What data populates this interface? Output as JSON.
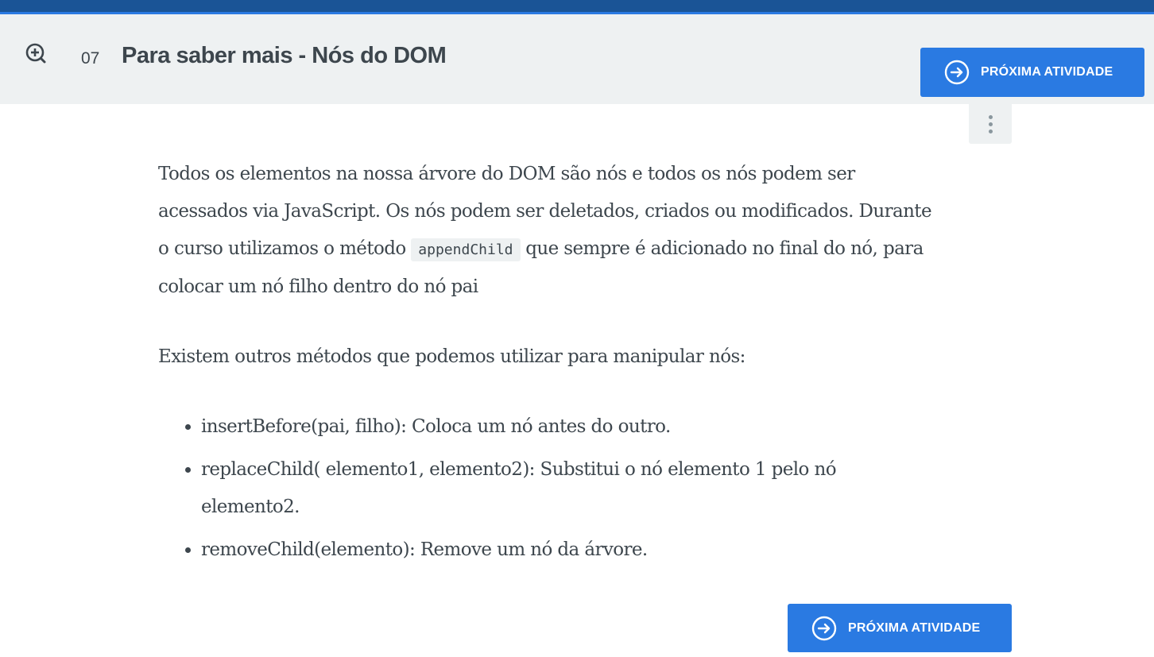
{
  "header": {
    "lesson_number": "07",
    "title": "Para saber mais - Nós do DOM",
    "next_button_label": "PRÓXIMA ATIVIDADE"
  },
  "content": {
    "paragraph1_part1": "Todos os elementos na nossa árvore do DOM são nós e todos os nós podem ser acessados via JavaScript. Os nós podem ser deletados, criados ou modificados. Durante o curso utilizamos o método ",
    "paragraph1_code": "appendChild",
    "paragraph1_part2": " que sempre é adicionado no final do nó, para colocar um nó filho dentro do nó pai",
    "paragraph2": "Existem outros métodos que podemos utilizar para manipular nós:",
    "methods": [
      "insertBefore(pai, filho): Coloca um nó antes do outro.",
      "replaceChild( elemento1, elemento2): Substitui o nó elemento 1 pelo nó elemento2.",
      "removeChild(elemento): Remove um nó da árvore."
    ]
  },
  "footer": {
    "next_button_label": "PRÓXIMA ATIVIDADE"
  },
  "icons": {
    "add": "zoom-plus-icon",
    "next": "arrow-right-circle-icon",
    "menu": "more-vertical-icon"
  },
  "colors": {
    "top_bar": "#1a5496",
    "accent": "#2a7ae2",
    "header_bg": "#eef1f2",
    "text": "#3d464d"
  }
}
